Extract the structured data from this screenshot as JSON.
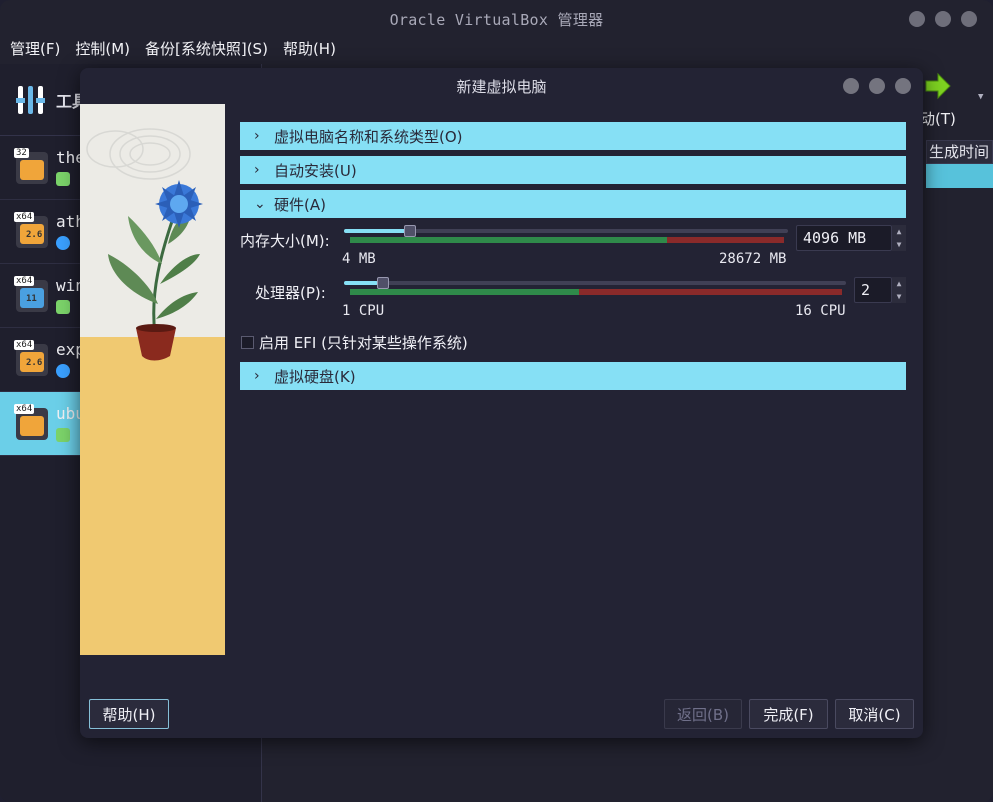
{
  "main": {
    "title": "Oracle VirtualBox 管理器",
    "menu": [
      "管理(F)",
      "控制(M)",
      "备份[系统快照](S)",
      "帮助(H)"
    ],
    "tools_label": "工具",
    "vms": [
      {
        "name": "the",
        "badge": "32",
        "ver": "",
        "state_icon": "running-icon"
      },
      {
        "name": "ath",
        "badge": "x64",
        "ver": "2.6",
        "state_icon": "power-icon"
      },
      {
        "name": "win",
        "badge": "x64",
        "ver": "11",
        "state_icon": "running-icon"
      },
      {
        "name": "exp",
        "badge": "x64",
        "ver": "2.6",
        "state_icon": "power-icon"
      },
      {
        "name": "ubu",
        "badge": "x64",
        "ver": "",
        "state_icon": "running-icon"
      }
    ],
    "start_label": "动(T)",
    "column_header": "生成时间"
  },
  "dialog": {
    "title": "新建虚拟电脑",
    "sections": {
      "name_os": "虚拟电脑名称和系统类型(O)",
      "auto_install": "自动安装(U)",
      "hardware": "硬件(A)",
      "disk": "虚拟硬盘(K)"
    },
    "memory": {
      "label": "内存大小(M):",
      "value": "4096 MB",
      "min_label": "4 MB",
      "max_label": "28672 MB",
      "fraction": 0.143
    },
    "cpu": {
      "label": "处理器(P):",
      "value": "2",
      "min_label": "1 CPU",
      "max_label": "16 CPU",
      "fraction": 0.067
    },
    "efi": {
      "label": "启用 EFI (只针对某些操作系统)",
      "checked": false
    },
    "buttons": {
      "help": "帮助(H)",
      "back": "返回(B)",
      "finish": "完成(F)",
      "cancel": "取消(C)"
    }
  },
  "colors": {
    "accent": "#86e0f5",
    "selected_row": "#6bcfe8",
    "bg": "#22222f",
    "scale_green": "#2f8a4a",
    "scale_red": "#8a2a2a"
  }
}
